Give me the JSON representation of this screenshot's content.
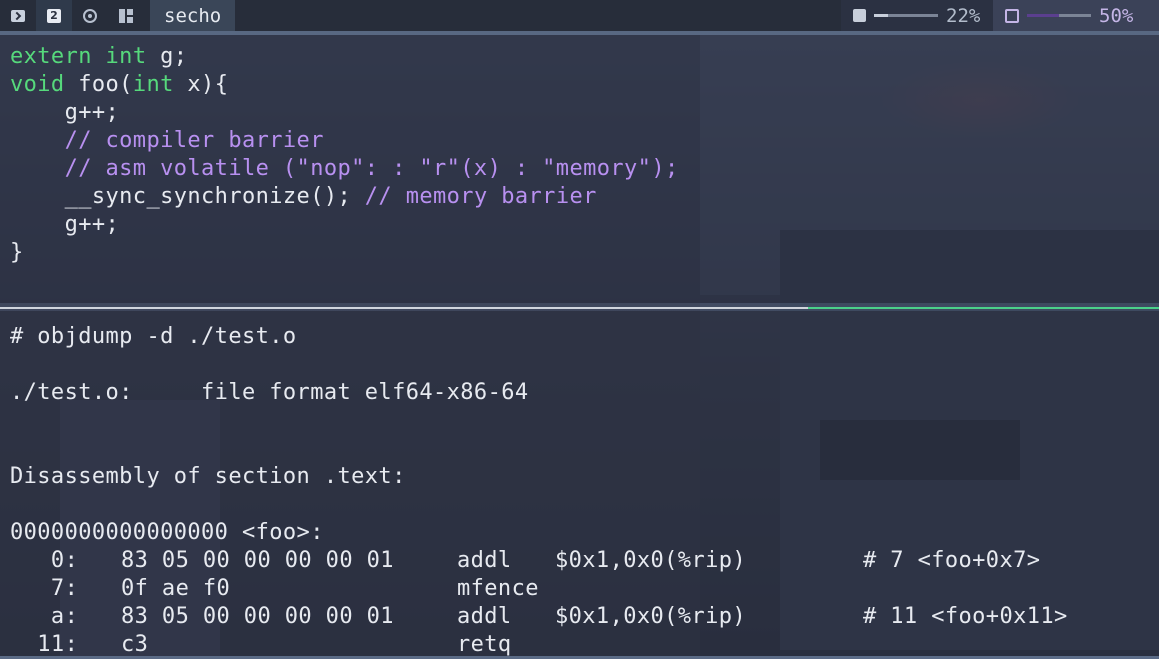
{
  "colors": {
    "keyword": "#56d97c",
    "comment": "#b890f0",
    "text": "#e7eaf0",
    "mem_fill": "#c8cfdb",
    "cpu_fill": "#5b3f8f",
    "separator_active": "#4bd08a"
  },
  "topbar": {
    "workspaces": [
      {
        "icon": "terminal-icon"
      },
      {
        "icon": "workspace-2-icon",
        "label": "2",
        "active": true
      },
      {
        "icon": "chrome-icon"
      },
      {
        "icon": "layout-icon"
      }
    ],
    "window_title": "secho",
    "memory": {
      "icon": "memory-icon",
      "percent_text": "22%",
      "fraction": 0.22
    },
    "cpu": {
      "icon": "cpu-icon",
      "percent_text": "50%",
      "fraction": 0.5
    }
  },
  "editor": {
    "l1_kw1": "extern",
    "l1_kw2": "int",
    "l1_rest": " g;",
    "l2_kw1": "void",
    "l2_mid": " foo(",
    "l2_kw2": "int",
    "l2_rest": " x){",
    "l3": "    g++;",
    "l4": "    // compiler barrier",
    "l5": "    // asm volatile (\"nop\": : \"r\"(x) : \"memory\");",
    "l6_code": "    __sync_synchronize(); ",
    "l6_comment": "// memory barrier",
    "l7": "    g++;",
    "l8": "}"
  },
  "terminal": {
    "command": "# objdump -d ./test.o",
    "file_line": "./test.o:     file format elf64-x86-64",
    "section_line": "Disassembly of section .text:",
    "symbol_line": "0000000000000000 <foo>:",
    "rows": [
      {
        "addr": "   0:",
        "bytes": "83 05 00 00 00 00 01",
        "mnemonic": "addl",
        "operands": "$0x1,0x0(%rip)",
        "comment": "# 7 <foo+0x7>"
      },
      {
        "addr": "   7:",
        "bytes": "0f ae f0",
        "mnemonic": "mfence",
        "operands": "",
        "comment": ""
      },
      {
        "addr": "   a:",
        "bytes": "83 05 00 00 00 00 01",
        "mnemonic": "addl",
        "operands": "$0x1,0x0(%rip)",
        "comment": "# 11 <foo+0x11>"
      },
      {
        "addr": "  11:",
        "bytes": "c3",
        "mnemonic": "retq",
        "operands": "",
        "comment": ""
      }
    ]
  }
}
